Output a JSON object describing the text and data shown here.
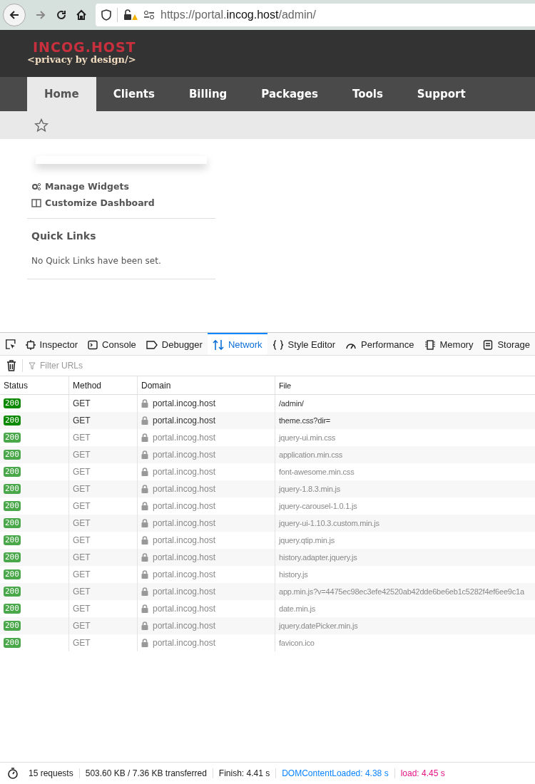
{
  "browser": {
    "url_prefix": "https://portal.",
    "url_host": "incog.host",
    "url_path": "/admin/"
  },
  "site": {
    "brand": "INCOG.HOST",
    "tagline": "<privacy by design/>"
  },
  "nav": [
    {
      "label": "Home",
      "selected": true
    },
    {
      "label": "Clients",
      "selected": false
    },
    {
      "label": "Billing",
      "selected": false
    },
    {
      "label": "Packages",
      "selected": false
    },
    {
      "label": "Tools",
      "selected": false
    },
    {
      "label": "Support",
      "selected": false
    }
  ],
  "dashboard": {
    "actions": [
      {
        "kind": "widgets",
        "label": "Manage Widgets"
      },
      {
        "kind": "layout",
        "label": "Customize Dashboard"
      }
    ],
    "quick_links": {
      "title": "Quick Links",
      "message": "No Quick Links have been set."
    }
  },
  "devtools": {
    "tabs": [
      {
        "kind": "inspector",
        "label": "Inspector",
        "selected": false
      },
      {
        "kind": "console",
        "label": "Console",
        "selected": false
      },
      {
        "kind": "debugger",
        "label": "Debugger",
        "selected": false
      },
      {
        "kind": "network",
        "label": "Network",
        "selected": true
      },
      {
        "kind": "style",
        "label": "Style Editor",
        "selected": false
      },
      {
        "kind": "performance",
        "label": "Performance",
        "selected": false
      },
      {
        "kind": "memory",
        "label": "Memory",
        "selected": false
      },
      {
        "kind": "storage",
        "label": "Storage",
        "selected": false
      }
    ],
    "filter": {
      "placeholder": "Filter URLs"
    },
    "columns": [
      "Status",
      "Method",
      "Domain",
      "File"
    ],
    "rows": [
      {
        "status": "200",
        "method": "GET",
        "domain": "portal.incog.host",
        "file": "/admin/",
        "cached": false
      },
      {
        "status": "200",
        "method": "GET",
        "domain": "portal.incog.host",
        "file": "theme.css?dir=",
        "cached": false
      },
      {
        "status": "200",
        "method": "GET",
        "domain": "portal.incog.host",
        "file": "jquery-ui.min.css",
        "cached": true
      },
      {
        "status": "200",
        "method": "GET",
        "domain": "portal.incog.host",
        "file": "application.min.css",
        "cached": true
      },
      {
        "status": "200",
        "method": "GET",
        "domain": "portal.incog.host",
        "file": "font-awesome.min.css",
        "cached": true
      },
      {
        "status": "200",
        "method": "GET",
        "domain": "portal.incog.host",
        "file": "jquery-1.8.3.min.js",
        "cached": true
      },
      {
        "status": "200",
        "method": "GET",
        "domain": "portal.incog.host",
        "file": "jquery-carousel-1.0.1.js",
        "cached": true
      },
      {
        "status": "200",
        "method": "GET",
        "domain": "portal.incog.host",
        "file": "jquery-ui-1.10.3.custom.min.js",
        "cached": true
      },
      {
        "status": "200",
        "method": "GET",
        "domain": "portal.incog.host",
        "file": "jquery.qtip.min.js",
        "cached": true
      },
      {
        "status": "200",
        "method": "GET",
        "domain": "portal.incog.host",
        "file": "history.adapter.jquery.js",
        "cached": true
      },
      {
        "status": "200",
        "method": "GET",
        "domain": "portal.incog.host",
        "file": "history.js",
        "cached": true
      },
      {
        "status": "200",
        "method": "GET",
        "domain": "portal.incog.host",
        "file": "app.min.js?v=4475ec98ec3efe42520ab42dde6be6eb1c5282f4ef6ee9c1a",
        "cached": true
      },
      {
        "status": "200",
        "method": "GET",
        "domain": "portal.incog.host",
        "file": "date.min.js",
        "cached": true
      },
      {
        "status": "200",
        "method": "GET",
        "domain": "portal.incog.host",
        "file": "jquery.datePicker.min.js",
        "cached": true
      },
      {
        "status": "200",
        "method": "GET",
        "domain": "portal.incog.host",
        "file": "favicon.ico",
        "cached": true
      }
    ],
    "summary": {
      "requests": "15 requests",
      "size": "503.60 KB / 7.36 KB transferred",
      "finish": "Finish: 4.41 s",
      "dom": "DOMContentLoaded: 4.38 s",
      "load": "load: 4.45 s"
    }
  }
}
